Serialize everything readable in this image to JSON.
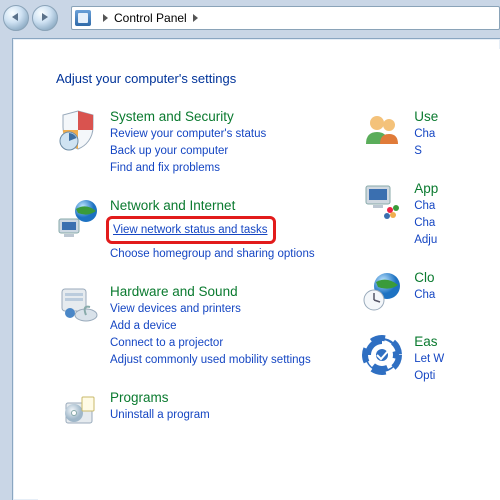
{
  "nav": {
    "crumb_label": "Control Panel"
  },
  "heading": "Adjust your computer's settings",
  "left": [
    {
      "icon": "shield",
      "title": "System and Security",
      "links": [
        "Review your computer's status",
        "Back up your computer",
        "Find and fix problems"
      ]
    },
    {
      "icon": "network",
      "title": "Network and Internet",
      "links": [
        "View network status and tasks",
        "Choose homegroup and sharing options"
      ],
      "highlight_index": 0
    },
    {
      "icon": "hardware",
      "title": "Hardware and Sound",
      "links": [
        "View devices and printers",
        "Add a device",
        "Connect to a projector",
        "Adjust commonly used mobility settings"
      ]
    },
    {
      "icon": "programs",
      "title": "Programs",
      "links": [
        "Uninstall a program"
      ]
    }
  ],
  "right": [
    {
      "icon": "users",
      "title": "Use",
      "links": [
        "Cha",
        "S"
      ]
    },
    {
      "icon": "appearance",
      "title": "App",
      "links": [
        "Cha",
        "Cha",
        "Adju"
      ]
    },
    {
      "icon": "clock",
      "title": "Clo",
      "links": [
        "Cha"
      ]
    },
    {
      "icon": "ease",
      "title": "Eas",
      "links": [
        "Let W",
        "Opti"
      ]
    }
  ],
  "highlight_color": "#e21b1b"
}
